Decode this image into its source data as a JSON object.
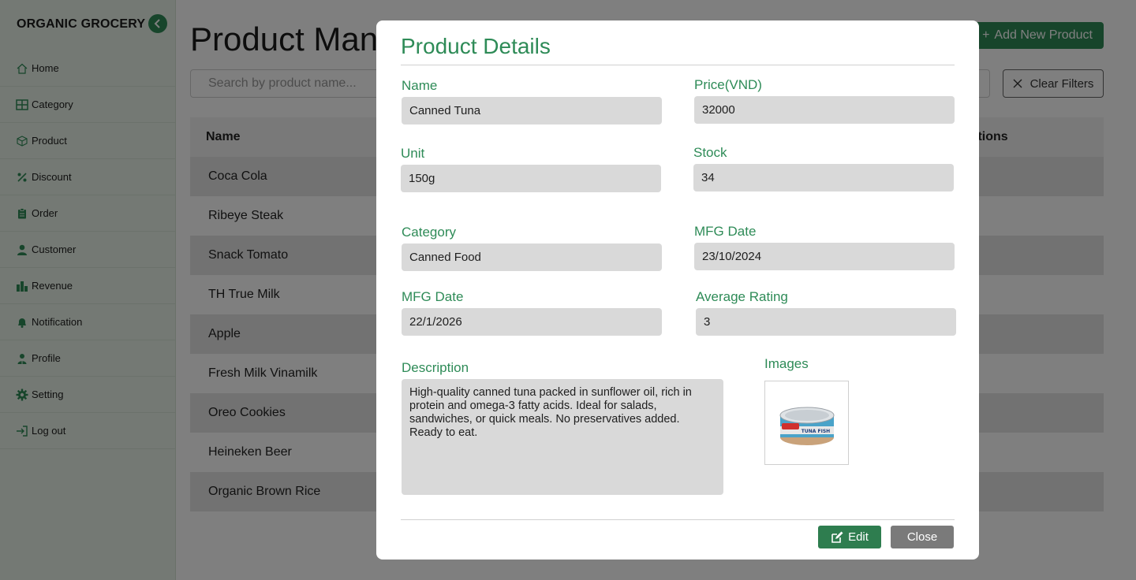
{
  "sidebar": {
    "brand": "ORGANIC GROCERY",
    "items": [
      {
        "label": "Home",
        "icon": "home-icon"
      },
      {
        "label": "Category",
        "icon": "grid-icon"
      },
      {
        "label": "Product",
        "icon": "box-icon"
      },
      {
        "label": "Discount",
        "icon": "percent-icon"
      },
      {
        "label": "Order",
        "icon": "clipboard-icon"
      },
      {
        "label": "Customer",
        "icon": "user-icon"
      },
      {
        "label": "Revenue",
        "icon": "bar-chart-icon"
      },
      {
        "label": "Notification",
        "icon": "bell-icon"
      },
      {
        "label": "Profile",
        "icon": "profile-icon"
      },
      {
        "label": "Setting",
        "icon": "gear-icon"
      },
      {
        "label": "Log out",
        "icon": "logout-icon"
      }
    ]
  },
  "main": {
    "title": "Product Management",
    "add_button": "Add New Product",
    "search_placeholder": "Search by product name...",
    "clear_filters": "Clear Filters",
    "table": {
      "headers": [
        "Name",
        "Actions"
      ],
      "rows": [
        "Coca Cola",
        "Ribeye Steak",
        "Snack Tomato",
        "TH True Milk",
        "Apple",
        "Fresh Milk Vinamilk",
        "Oreo Cookies",
        "Heineken Beer",
        "Organic Brown Rice"
      ]
    }
  },
  "modal": {
    "title": "Product Details",
    "fields": {
      "name": {
        "label": "Name",
        "value": "Canned Tuna"
      },
      "price": {
        "label": "Price(VND)",
        "value": "32000"
      },
      "unit": {
        "label": "Unit",
        "value": "150g"
      },
      "stock": {
        "label": "Stock",
        "value": "34"
      },
      "category": {
        "label": "Category",
        "value": "Canned Food"
      },
      "mfg_date": {
        "label": "MFG Date",
        "value": "23/10/2024"
      },
      "exp_date": {
        "label": "MFG Date",
        "value": "22/1/2026"
      },
      "rating": {
        "label": "Average Rating",
        "value": "3"
      }
    },
    "description": {
      "label": "Description",
      "value": "High-quality canned tuna packed in sunflower oil, rich in protein and omega-3 fatty acids. Ideal for salads, sandwiches, or quick meals. No preservatives added. Ready to eat."
    },
    "images_label": "Images",
    "image_caption": "TUNA FISH",
    "edit_button": "Edit",
    "close_button": "Close"
  },
  "colors": {
    "accent": "#2e8b57",
    "sidebar_bg": "#e9f3e8",
    "field_bg": "#d9d9d9",
    "close_bg": "#7a7a7a"
  }
}
